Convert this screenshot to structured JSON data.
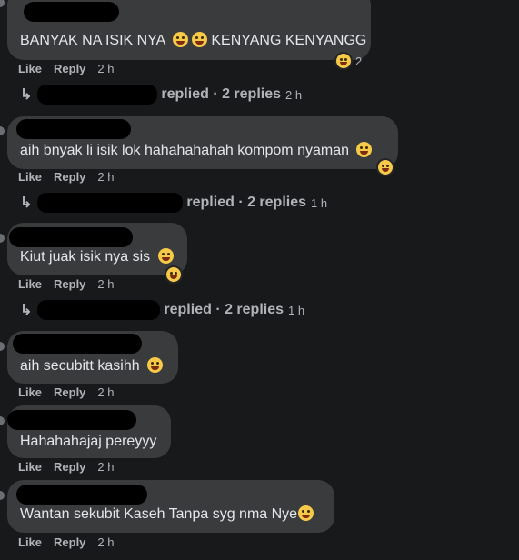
{
  "actions": {
    "like": "Like",
    "reply": "Reply"
  },
  "comments": [
    {
      "text": "BANYAK NA ISIK NYA",
      "text2": "KENYANG KENYANGG",
      "time": "2 h",
      "reaction_count": "2",
      "replied": "replied · 2 replies",
      "reply_time": "2 h"
    },
    {
      "text": "aih bnyak li isik lok hahahahahah kompom nyaman",
      "time": "2 h",
      "replied": "replied · 2 replies",
      "reply_time": "1 h"
    },
    {
      "text": "Kiut juak isik nya sis",
      "time": "2 h",
      "replied": "replied · 2 replies",
      "reply_time": "1 h"
    },
    {
      "text": "aih secubitt kasihh",
      "time": "2 h"
    },
    {
      "text": "Hahahahajaj pereyyy",
      "time": "2 h"
    },
    {
      "text": "Wantan sekubit Kaseh Tanpa syg nma Nye",
      "time": "2 h"
    }
  ],
  "icons": {
    "reply_arrow": "reply-arrow-icon",
    "emoji": "laughing-emoji-icon"
  },
  "colors": {
    "background": "#18191a",
    "bubble": "#3a3b3c",
    "text": "#e4e6eb",
    "muted": "#b0b3b8",
    "emoji": "#f7c948"
  }
}
